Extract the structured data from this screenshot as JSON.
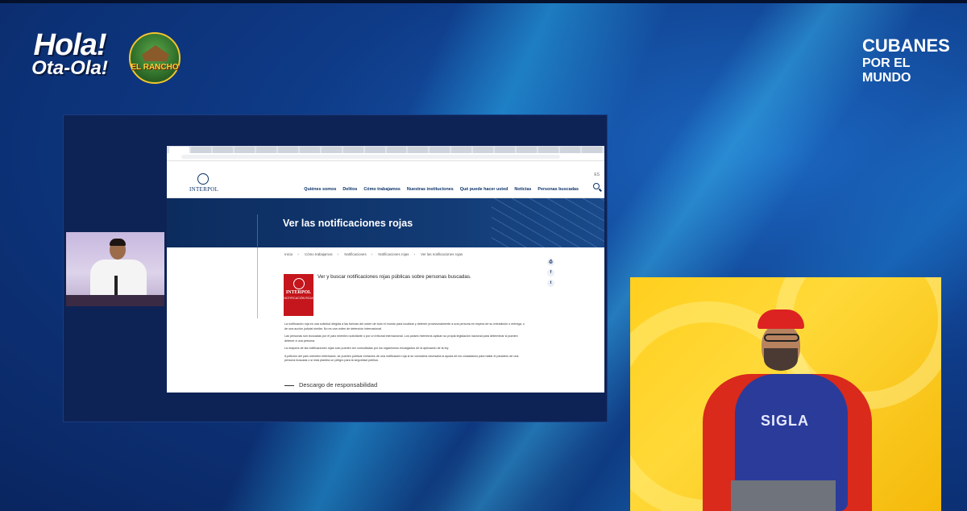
{
  "brand": {
    "hola_line1": "Hola!",
    "hola_line2": "Ota-Ola!",
    "rancho": "EL RANCHO",
    "cubanes_line1": "CUBANES",
    "cubanes_line2": "POR EL MUNDO"
  },
  "site": {
    "logo_text": "INTERPOL",
    "nav": [
      "Quiénes somos",
      "Delitos",
      "Cómo trabajamos",
      "Nuestras instituciones",
      "Qué puede hacer usted",
      "Noticias",
      "Personas buscadas"
    ],
    "language": "ES",
    "page_title": "Ver las notificaciones rojas",
    "breadcrumbs": [
      "Inicio",
      "Cómo trabajamos",
      "Notificaciones",
      "Notificaciones rojas",
      "Ver las notificaciones rojas"
    ],
    "intro": "Ver y buscar notificaciones rojas públicas sobre personas buscadas.",
    "badge_line1": "INTERPOL",
    "badge_line2": "NOTIFICACIÓN ROJA",
    "paragraphs": [
      "La notificación roja es una solicitud dirigida a las fuerzas del orden de todo el mundo para localizar y detener provisionalmente a una persona en espera de su extradición o entrega, o de una acción judicial similar. No es una orden de detención internacional.",
      "Las personas son buscadas por el país miembro solicitante o por un tribunal internacional. Los países miembros aplican su propia legislación nacional para determinar si pueden detener a una persona.",
      "La mayoría de las notificaciones rojas solo pueden ser consultadas por los organismos encargados de la aplicación de la ley.",
      "A petición del país miembro interesado, se pueden publicar extractos de una notificación roja si se considera necesaria la ayuda de los ciudadanos para hallar el paradero de una persona buscada o si esta plantea un peligro para la seguridad pública."
    ],
    "disclaimer": "Descargo de responsabilidad"
  },
  "guest": {
    "hoodie_text": "SIGLA"
  }
}
